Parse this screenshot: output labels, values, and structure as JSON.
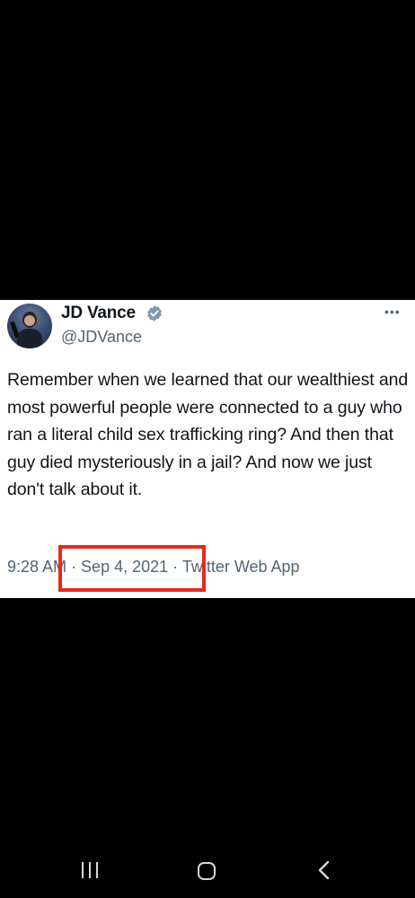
{
  "tweet": {
    "display_name": "JD Vance",
    "handle": "@JDVance",
    "verified": true,
    "more_icon": "more-horizontal-icon",
    "text": "Remember when we learned that our wealthiest and most powerful people were connected to a guy who ran a literal child sex trafficking ring? And then that guy died mysteriously in a jail? And now we just don't talk about it.",
    "meta": {
      "time": "9:28 AM",
      "separator": " · ",
      "date": "Sep 4, 2021",
      "source": "Twitter Web App"
    }
  },
  "annotation": {
    "highlight_color": "#e8281f",
    "highlighted_field": "date"
  },
  "colors": {
    "background": "#000000",
    "card": "#ffffff",
    "text_primary": "#0f1419",
    "text_secondary": "#536471",
    "verified_badge": "#829aab"
  },
  "navbar": {
    "recents_icon": "recent-apps-icon",
    "home_icon": "home-icon",
    "back_icon": "back-chevron-icon"
  }
}
